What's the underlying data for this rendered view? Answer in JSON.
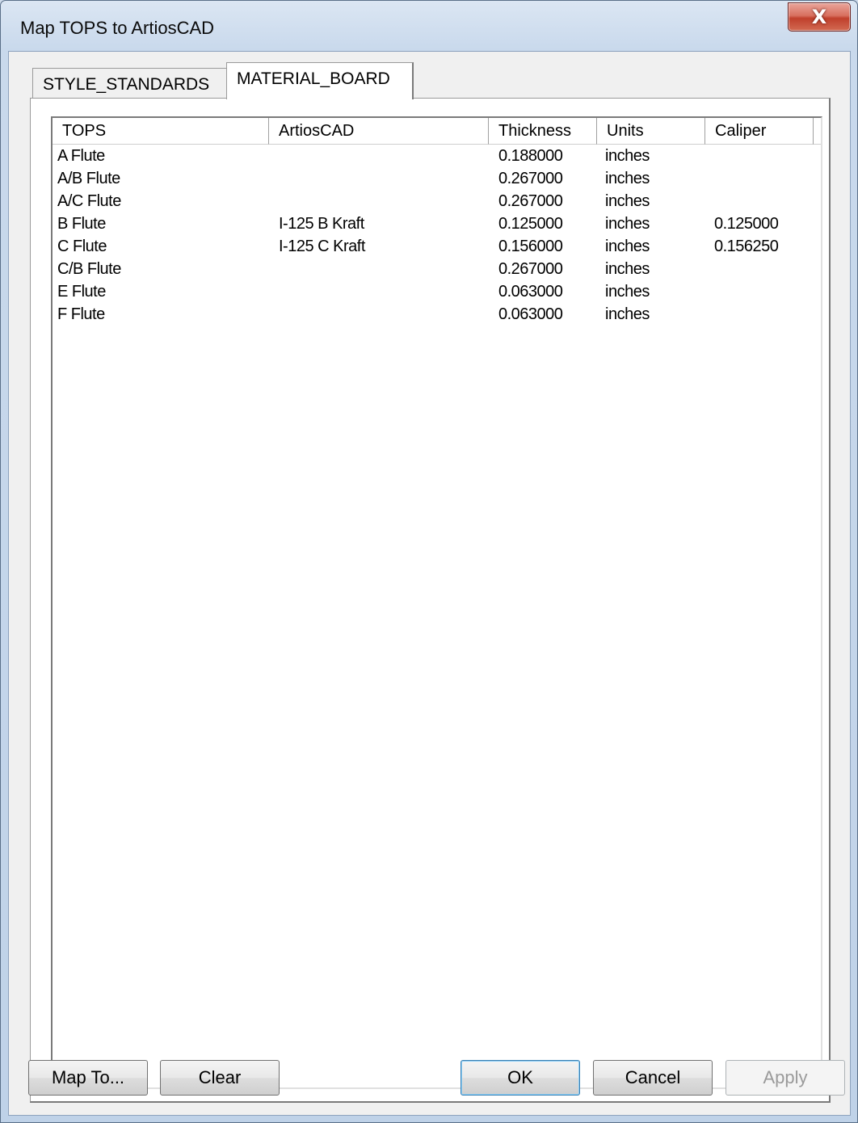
{
  "window": {
    "title": "Map TOPS to ArtiosCAD",
    "close_glyph": "X"
  },
  "tabs": [
    {
      "label": "STYLE_STANDARDS",
      "active": false
    },
    {
      "label": "MATERIAL_BOARD",
      "active": true
    }
  ],
  "table": {
    "columns": [
      "TOPS",
      "ArtiosCAD",
      "Thickness",
      "Units",
      "Caliper"
    ],
    "rows": [
      {
        "tops": "A Flute",
        "artioscad": "",
        "thickness": "0.188000",
        "units": "inches",
        "caliper": ""
      },
      {
        "tops": "A/B Flute",
        "artioscad": "",
        "thickness": "0.267000",
        "units": "inches",
        "caliper": ""
      },
      {
        "tops": "A/C Flute",
        "artioscad": "",
        "thickness": "0.267000",
        "units": "inches",
        "caliper": ""
      },
      {
        "tops": "B Flute",
        "artioscad": "I-125 B Kraft",
        "thickness": "0.125000",
        "units": "inches",
        "caliper": "0.125000"
      },
      {
        "tops": "C Flute",
        "artioscad": "I-125 C Kraft",
        "thickness": "0.156000",
        "units": "inches",
        "caliper": "0.156250"
      },
      {
        "tops": "C/B Flute",
        "artioscad": "",
        "thickness": "0.267000",
        "units": "inches",
        "caliper": ""
      },
      {
        "tops": "E Flute",
        "artioscad": "",
        "thickness": "0.063000",
        "units": "inches",
        "caliper": ""
      },
      {
        "tops": "F Flute",
        "artioscad": "",
        "thickness": "0.063000",
        "units": "inches",
        "caliper": ""
      }
    ]
  },
  "buttons": {
    "map_to": "Map To...",
    "clear": "Clear",
    "ok": "OK",
    "cancel": "Cancel",
    "apply": "Apply"
  }
}
